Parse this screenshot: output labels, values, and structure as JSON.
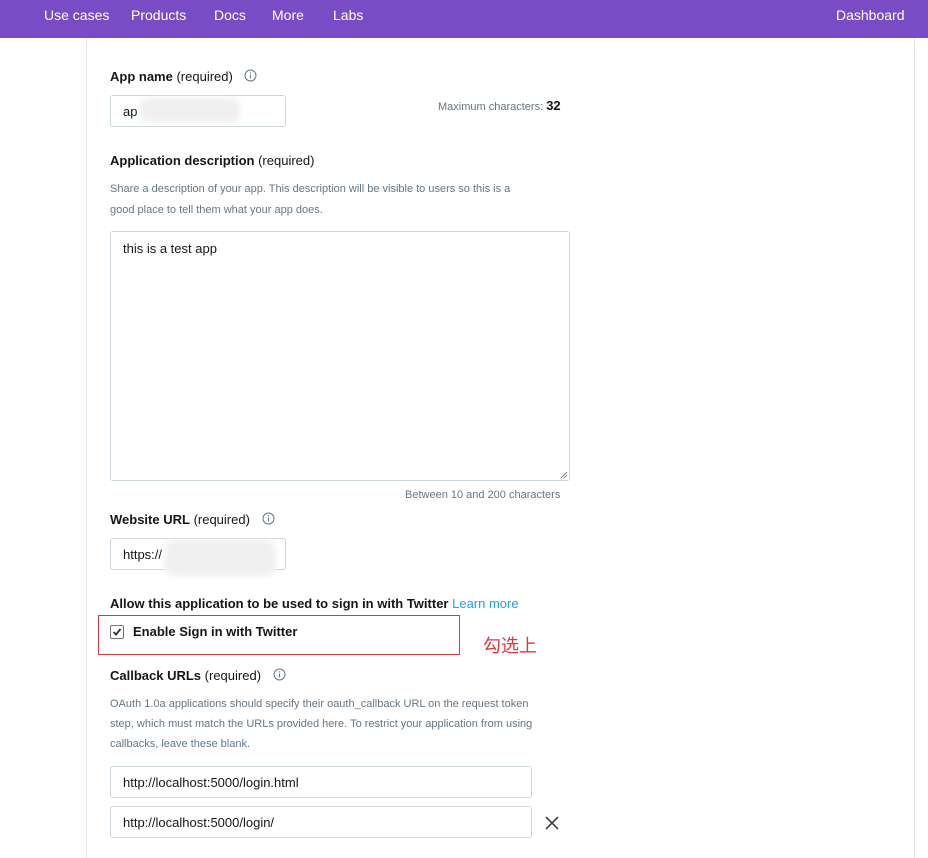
{
  "nav": {
    "items": [
      "Use cases",
      "Products",
      "Docs",
      "More",
      "Labs"
    ],
    "dashboard": "Dashboard"
  },
  "app_name": {
    "label": "App name",
    "required": "(required)",
    "value": "ap",
    "max_hint": "Maximum characters:",
    "max_value": "32"
  },
  "description": {
    "label": "Application description",
    "required": "(required)",
    "help_line1": "Share a description of your app. This description will be visible to users so this is a",
    "help_line2": "good place to tell them what your app does.",
    "value": "this is a test app",
    "length_hint": "Between 10 and 200 characters"
  },
  "website": {
    "label": "Website URL",
    "required": "(required)",
    "value": "https://"
  },
  "signin": {
    "title": "Allow this application to be used to sign in with Twitter",
    "learn_more": "Learn more",
    "checkbox_label": "Enable Sign in with Twitter",
    "checked": true,
    "annotation": "勾选上"
  },
  "callback": {
    "label": "Callback URLs",
    "required": "(required)",
    "help_line1": "OAuth 1.0a applications should specify their oauth_callback URL on the request token",
    "help_line2": "step, which must match the URLs provided here. To restrict your application from using",
    "help_line3": "callbacks, leave these blank.",
    "urls": [
      "http://localhost:5000/login.html",
      "http://localhost:5000/login/"
    ]
  },
  "colors": {
    "nav_bg": "#794bc4",
    "link": "#1da1f2",
    "annotation_red": "#e0373b"
  }
}
